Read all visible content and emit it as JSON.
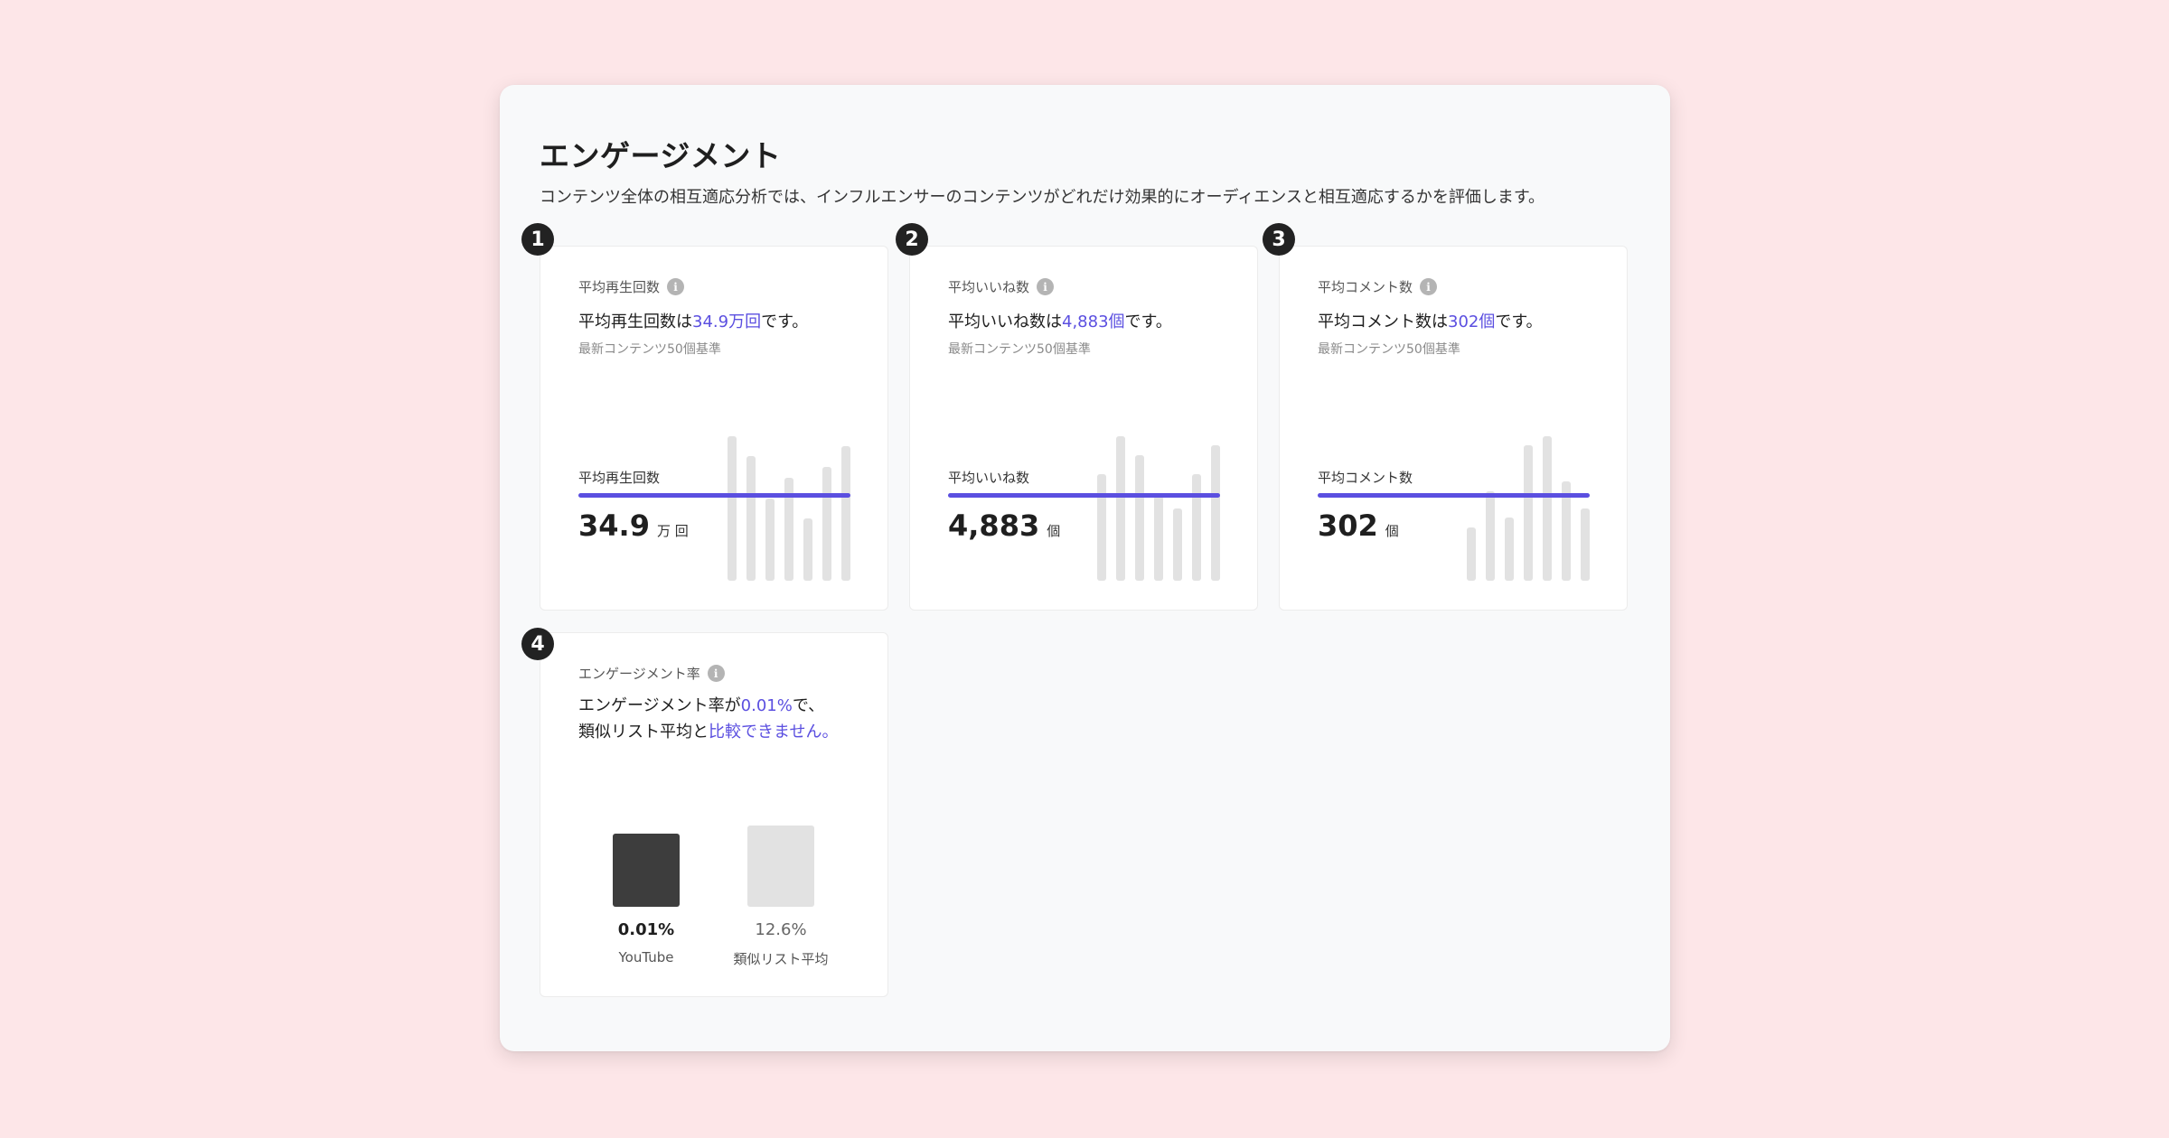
{
  "header": {
    "title": "エンゲージメント",
    "description": "コンテンツ全体の相互適応分析では、インフルエンサーのコンテンツがどれだけ効果的にオーディエンスと相互適応するかを評価します。"
  },
  "colors": {
    "accent": "#5b4fe0",
    "bar": "#e2e2e2",
    "primary_bar": "#3d3d3d",
    "background": "#fde6e8"
  },
  "cards": [
    {
      "badge": "1",
      "label": "平均再生回数",
      "sentence_prefix": "平均再生回数は",
      "sentence_highlight": "34.9万回",
      "sentence_suffix": "です。",
      "basis": "最新コンテンツ50個基準",
      "avg_label": "平均再生回数",
      "avg_value": "34.9",
      "avg_unit": "万 回",
      "bars": [
        1.0,
        0.86,
        0.57,
        0.71,
        0.43,
        0.79,
        0.93
      ]
    },
    {
      "badge": "2",
      "label": "平均いいね数",
      "sentence_prefix": "平均いいね数は",
      "sentence_highlight": "4,883個",
      "sentence_suffix": "です。",
      "basis": "最新コンテンツ50個基準",
      "avg_label": "平均いいね数",
      "avg_value": "4,883",
      "avg_unit": "個",
      "bars": [
        0.74,
        1.0,
        0.87,
        0.59,
        0.5,
        0.74,
        0.94
      ]
    },
    {
      "badge": "3",
      "label": "平均コメント数",
      "sentence_prefix": "平均コメント数は",
      "sentence_highlight": "302個",
      "sentence_suffix": "です。",
      "basis": "最新コンテンツ50個基準",
      "avg_label": "平均コメント数",
      "avg_value": "302",
      "avg_unit": "個",
      "bars": [
        0.37,
        0.62,
        0.44,
        0.94,
        1.0,
        0.69,
        0.5
      ]
    }
  ],
  "engagement": {
    "badge": "4",
    "label": "エンゲージメント率",
    "line1_prefix": "エンゲージメント率が",
    "line1_highlight": "0.01%",
    "line1_suffix": "で、",
    "line2_prefix": "類似リスト平均と",
    "line2_highlight": "比較できません。",
    "comparison": [
      {
        "name": "YouTube",
        "value": "0.01%",
        "level": 0.9
      },
      {
        "name": "類似リスト平均",
        "value": "12.6%",
        "level": 1.0
      }
    ]
  }
}
